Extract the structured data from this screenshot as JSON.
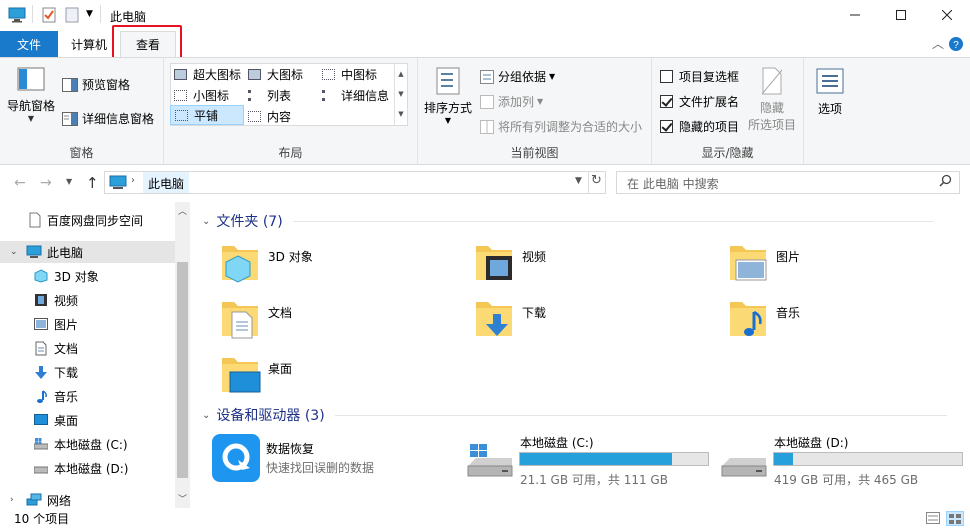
{
  "window": {
    "title": "此电脑"
  },
  "tabs": {
    "file": "文件",
    "computer": "计算机",
    "view": "查看"
  },
  "ribbon": {
    "pane": {
      "nav_pane": "导航窗格",
      "preview": "预览窗格",
      "details": "详细信息窗格",
      "label": "窗格"
    },
    "layout": {
      "xl_icons": "超大图标",
      "l_icons": "大图标",
      "m_icons": "中图标",
      "s_icons": "小图标",
      "list": "列表",
      "details": "详细信息",
      "tiles": "平铺",
      "content": "内容",
      "label": "布局"
    },
    "current_view": {
      "sort": "排序方式",
      "group": "分组依据",
      "add_col": "添加列",
      "fit_cols": "将所有列调整为合适的大小",
      "label": "当前视图"
    },
    "show_hide": {
      "item_check": "项目复选框",
      "ext": "文件扩展名",
      "hidden": "隐藏的项目",
      "hide": "隐藏",
      "hide_sel": "所选项目",
      "label": "显示/隐藏"
    },
    "options": "选项",
    "checks": {
      "item_check": false,
      "ext": true,
      "hidden": true
    }
  },
  "address": {
    "path": "此电脑",
    "search_placeholder": "在 此电脑 中搜索"
  },
  "nav": {
    "items": [
      {
        "label": "百度网盘同步空间",
        "icon": "doc-icon"
      },
      {
        "label": "此电脑",
        "icon": "computer-icon"
      },
      {
        "label": "3D 对象",
        "icon": "cube-icon"
      },
      {
        "label": "视频",
        "icon": "video-icon"
      },
      {
        "label": "图片",
        "icon": "picture-icon"
      },
      {
        "label": "文档",
        "icon": "document-icon"
      },
      {
        "label": "下载",
        "icon": "download-icon"
      },
      {
        "label": "音乐",
        "icon": "music-icon"
      },
      {
        "label": "桌面",
        "icon": "desktop-icon"
      },
      {
        "label": "本地磁盘 (C:)",
        "icon": "drive-icon"
      },
      {
        "label": "本地磁盘 (D:)",
        "icon": "drive-icon"
      },
      {
        "label": "网络",
        "icon": "network-icon"
      }
    ]
  },
  "main": {
    "folders_header": "文件夹 (7)",
    "folders": [
      {
        "label": "3D 对象",
        "icon": "cube-icon"
      },
      {
        "label": "视频",
        "icon": "video-icon"
      },
      {
        "label": "图片",
        "icon": "picture-icon"
      },
      {
        "label": "文档",
        "icon": "document-icon"
      },
      {
        "label": "下载",
        "icon": "download-icon"
      },
      {
        "label": "音乐",
        "icon": "music-icon"
      },
      {
        "label": "桌面",
        "icon": "desktop-icon"
      }
    ],
    "devices_header": "设备和驱动器 (3)",
    "app": {
      "name": "数据恢复",
      "desc": "快速找回误删的数据"
    },
    "drives": [
      {
        "name": "本地磁盘 (C:)",
        "info": "21.1 GB 可用，共 111 GB",
        "used": 0.81
      },
      {
        "name": "本地磁盘 (D:)",
        "info": "419 GB 可用，共 465 GB",
        "used": 0.1
      }
    ]
  },
  "status": {
    "count": "10 个项目"
  },
  "colors": {
    "accent": "#1979ca",
    "highlight": "#e81123",
    "selection": "#cce8ff"
  }
}
